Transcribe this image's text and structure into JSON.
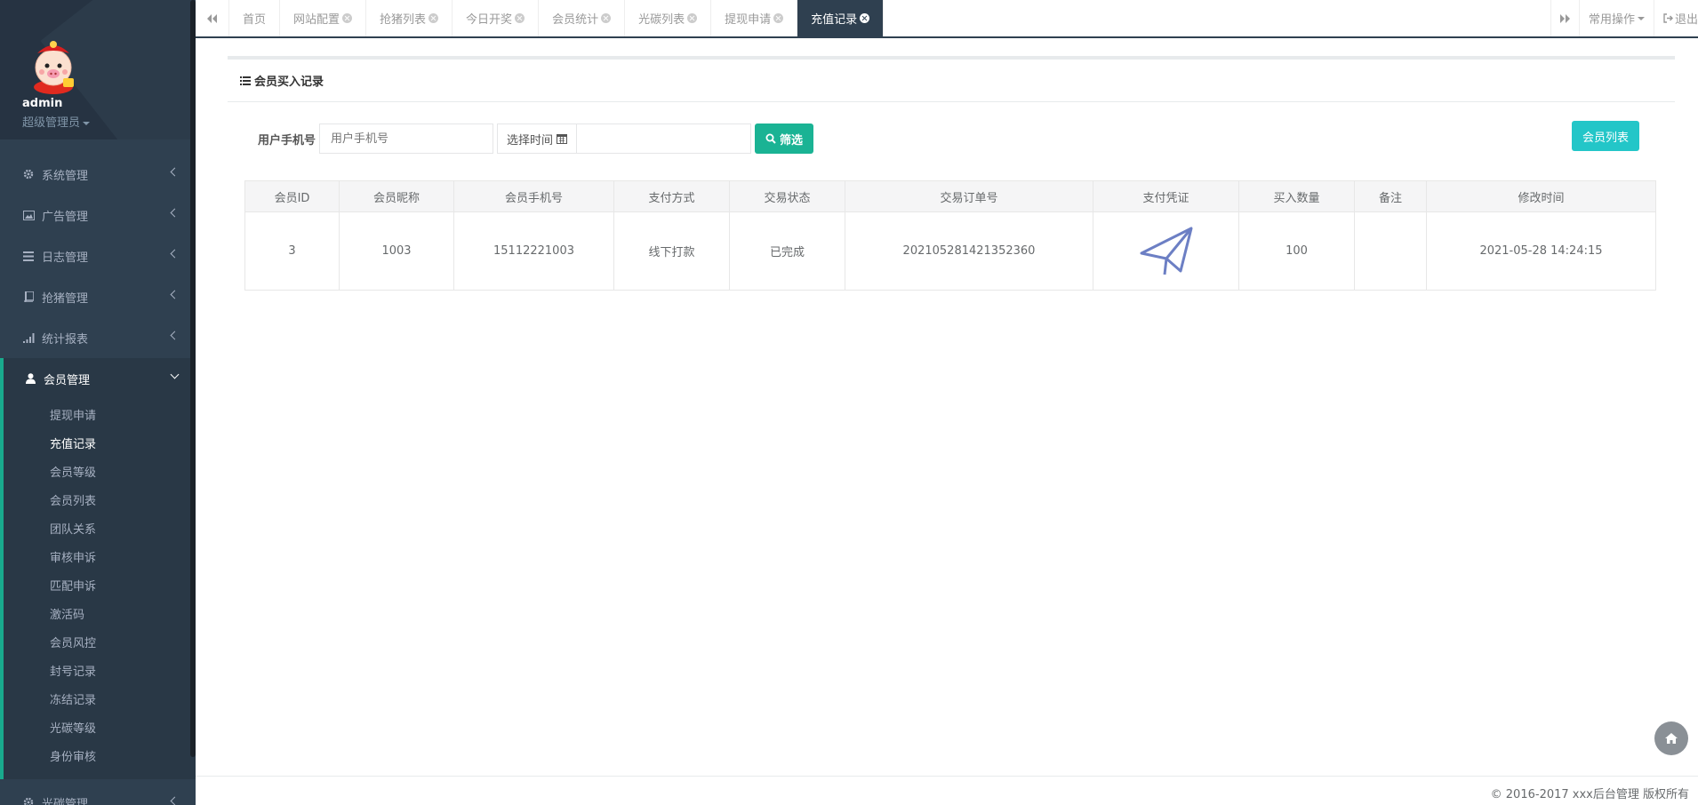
{
  "profile": {
    "name": "admin",
    "role": "超级管理员"
  },
  "nav": [
    {
      "label": "系统管理",
      "icon": "gear-icon"
    },
    {
      "label": "广告管理",
      "icon": "image-icon"
    },
    {
      "label": "日志管理",
      "icon": "list-icon"
    },
    {
      "label": "抢猪管理",
      "icon": "book-icon"
    },
    {
      "label": "统计报表",
      "icon": "signal-icon"
    },
    {
      "label": "会员管理",
      "icon": "user-icon",
      "active": true
    },
    {
      "label": "光碳管理",
      "icon": "gear-icon"
    }
  ],
  "subnav": [
    "提现申请",
    "充值记录",
    "会员等级",
    "会员列表",
    "团队关系",
    "审核申诉",
    "匹配申诉",
    "激活码",
    "会员风控",
    "封号记录",
    "冻结记录",
    "光碳等级",
    "身份审核"
  ],
  "tabs": [
    "首页",
    "网站配置",
    "抢猪列表",
    "今日开奖",
    "会员统计",
    "光碳列表",
    "提现申请",
    "充值记录"
  ],
  "tabbar_right": {
    "ops": "常用操作",
    "logout": "退出"
  },
  "page": {
    "title": "会员买入记录"
  },
  "filter": {
    "phone_label": "用户手机号",
    "phone_placeholder": "用户手机号",
    "time_label": "选择时间",
    "search_btn": "筛选",
    "member_list_btn": "会员列表"
  },
  "table": {
    "headers": [
      "会员ID",
      "会员昵称",
      "会员手机号",
      "支付方式",
      "交易状态",
      "交易订单号",
      "支付凭证",
      "买入数量",
      "备注",
      "修改时间"
    ],
    "rows": [
      [
        "3",
        "1003",
        "15112221003",
        "线下打款",
        "已完成",
        "202105281421352360",
        "",
        "100",
        "",
        "2021-05-28 14:24:15"
      ]
    ]
  },
  "footer": {
    "copyright": "© 2016-2017 xxx后台管理 版权所有"
  },
  "colors": {
    "sidebar": "#2f4050",
    "accent": "#19aa8d",
    "btn_green": "#1ab394",
    "btn_cyan": "#23c6c8"
  }
}
